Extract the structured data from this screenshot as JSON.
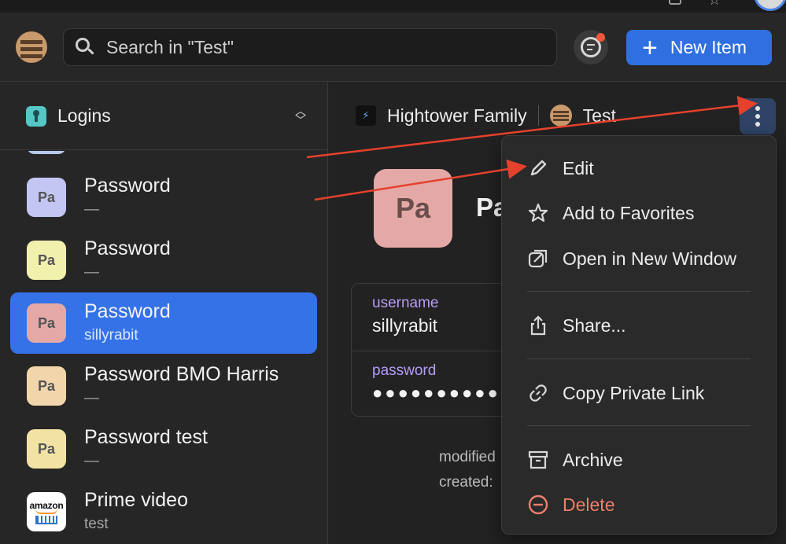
{
  "header": {
    "search_placeholder": "Search in \"Test\"",
    "new_item_label": "New Item"
  },
  "sidebar": {
    "category_label": "Logins",
    "items": [
      {
        "title": "",
        "subtitle": "—",
        "initials": "",
        "color": "#b7c8ec"
      },
      {
        "title": "Password",
        "subtitle": "—",
        "initials": "Pa",
        "color": "#c3c6f3"
      },
      {
        "title": "Password",
        "subtitle": "—",
        "initials": "Pa",
        "color": "#f2f0ad"
      },
      {
        "title": "Password",
        "subtitle": "sillyrabit",
        "initials": "Pa",
        "color": "#e4a9a6",
        "selected": true
      },
      {
        "title": "Password BMO Harris",
        "subtitle": "—",
        "initials": "Pa",
        "color": "#f2d6ab"
      },
      {
        "title": "Password test",
        "subtitle": "—",
        "initials": "Pa",
        "color": "#f2e3a4"
      },
      {
        "title": "Prime video",
        "subtitle": "test",
        "icon": "amazon-logo",
        "amazon_text": "amazon"
      }
    ]
  },
  "detail": {
    "account_name": "Hightower Family",
    "vault_name": "Test",
    "big_icon_initials": "Pa",
    "title_partial": "Pa",
    "fields": [
      {
        "label": "username",
        "value": "sillyrabit"
      },
      {
        "label": "password",
        "value": "●●●●●●●●●●"
      }
    ],
    "modified_label": "modified",
    "created_label": "created:"
  },
  "context_menu": {
    "items": [
      {
        "label": "Edit",
        "icon": "pencil-icon"
      },
      {
        "label": "Add to Favorites",
        "icon": "star-icon"
      },
      {
        "label": "Open in New Window",
        "icon": "open-window-icon"
      },
      {
        "label": "Share...",
        "icon": "share-icon"
      },
      {
        "label": "Copy Private Link",
        "icon": "link-icon"
      },
      {
        "label": "Archive",
        "icon": "archive-icon"
      },
      {
        "label": "Delete",
        "icon": "delete-icon",
        "danger": true
      }
    ]
  },
  "colors": {
    "accent": "#3572e8",
    "new_item_bg": "#2f6fe0",
    "arrow": "#e5412d",
    "field_label": "#b69cf5",
    "danger": "#ee7f6b"
  }
}
